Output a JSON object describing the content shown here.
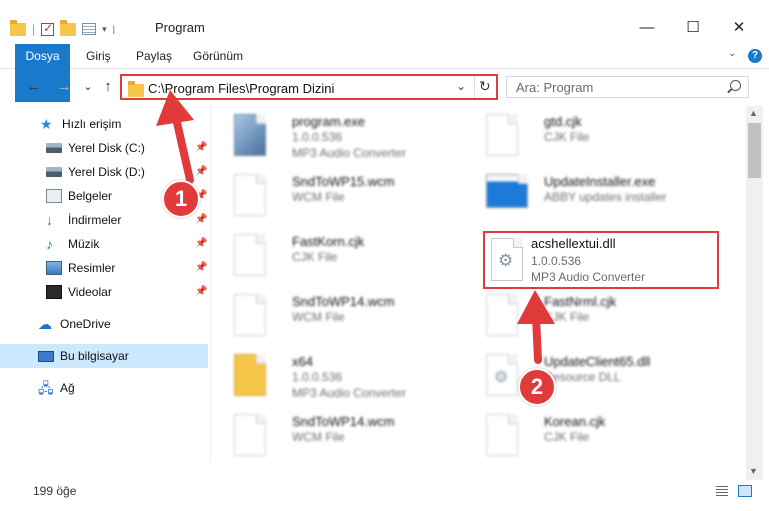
{
  "titlebar": {
    "title": "Program",
    "minimize": "—",
    "maximize": "☐",
    "close": "✕"
  },
  "ribbon": {
    "tabs": [
      "Dosya",
      "Giriş",
      "Paylaş",
      "Görünüm"
    ],
    "help": "?"
  },
  "nav": {
    "back": "←",
    "forward": "→",
    "recent": "⌄",
    "up": "↑",
    "address": "C:\\Program Files\\Program Dizini",
    "dropdown": "⌄",
    "refresh": "↻",
    "search_placeholder": "Ara: Program"
  },
  "sidebar": {
    "items": [
      {
        "label": "Hızlı erişim",
        "icon": "star-icon"
      },
      {
        "label": "Yerel Disk (C:)",
        "icon": "disk-icon",
        "pinned": true
      },
      {
        "label": "Yerel Disk (D:)",
        "icon": "disk-icon",
        "pinned": true
      },
      {
        "label": "Belgeler",
        "icon": "documents-icon",
        "pinned": true
      },
      {
        "label": "İndirmeler",
        "icon": "downloads-icon",
        "pinned": true
      },
      {
        "label": "Müzik",
        "icon": "music-icon",
        "pinned": true
      },
      {
        "label": "Resimler",
        "icon": "pictures-icon",
        "pinned": true
      },
      {
        "label": "Videolar",
        "icon": "videos-icon",
        "pinned": true
      },
      {
        "label": "OneDrive",
        "icon": "cloud-icon"
      },
      {
        "label": "Bu bilgisayar",
        "icon": "computer-icon",
        "selected": true
      },
      {
        "label": "Ağ",
        "icon": "network-icon"
      }
    ]
  },
  "files": [
    {
      "name": "program.exe",
      "line2": "1.0.0.536",
      "line3": "MP3 Audio Converter",
      "icon": "exe"
    },
    {
      "name": "gtd.cjk",
      "line2": "CJK File",
      "line3": "",
      "icon": "file"
    },
    {
      "name": "SndToWP15.wcm",
      "line2": "WCM File",
      "line3": "",
      "icon": "file"
    },
    {
      "name": "UpdateInstaller.exe",
      "line2": "ABBY updates installer",
      "line3": "",
      "icon": "blue"
    },
    {
      "name": "FastKorn.cjk",
      "line2": "CJK File",
      "line3": "",
      "icon": "file"
    },
    {
      "name": "SndToWP14.wcm",
      "line2": "WCM File",
      "line3": "",
      "icon": "file"
    },
    {
      "name": "FastNrml.cjk",
      "line2": "CJK File",
      "line3": "",
      "icon": "file"
    },
    {
      "name": "x64",
      "line2": "1.0.0.536",
      "line3": "MP3 Audio Converter",
      "icon": "folder"
    },
    {
      "name": "UpdateClient65.dll",
      "line2": "Resource DLL",
      "line3": "",
      "icon": "gear"
    },
    {
      "name": "SndToWP14.wcm",
      "line2": "WCM File",
      "line3": "",
      "icon": "file"
    },
    {
      "name": "Korean.cjk",
      "line2": "CJK File",
      "line3": "",
      "icon": "file"
    }
  ],
  "highlighted_file": {
    "name": "acshellextui.dll",
    "version": "1.0.0.536",
    "description": "MP3 Audio Converter"
  },
  "annotations": {
    "step1": "1",
    "step2": "2",
    "color": "#e03a3a"
  },
  "status": {
    "item_count": "199 öğe"
  }
}
